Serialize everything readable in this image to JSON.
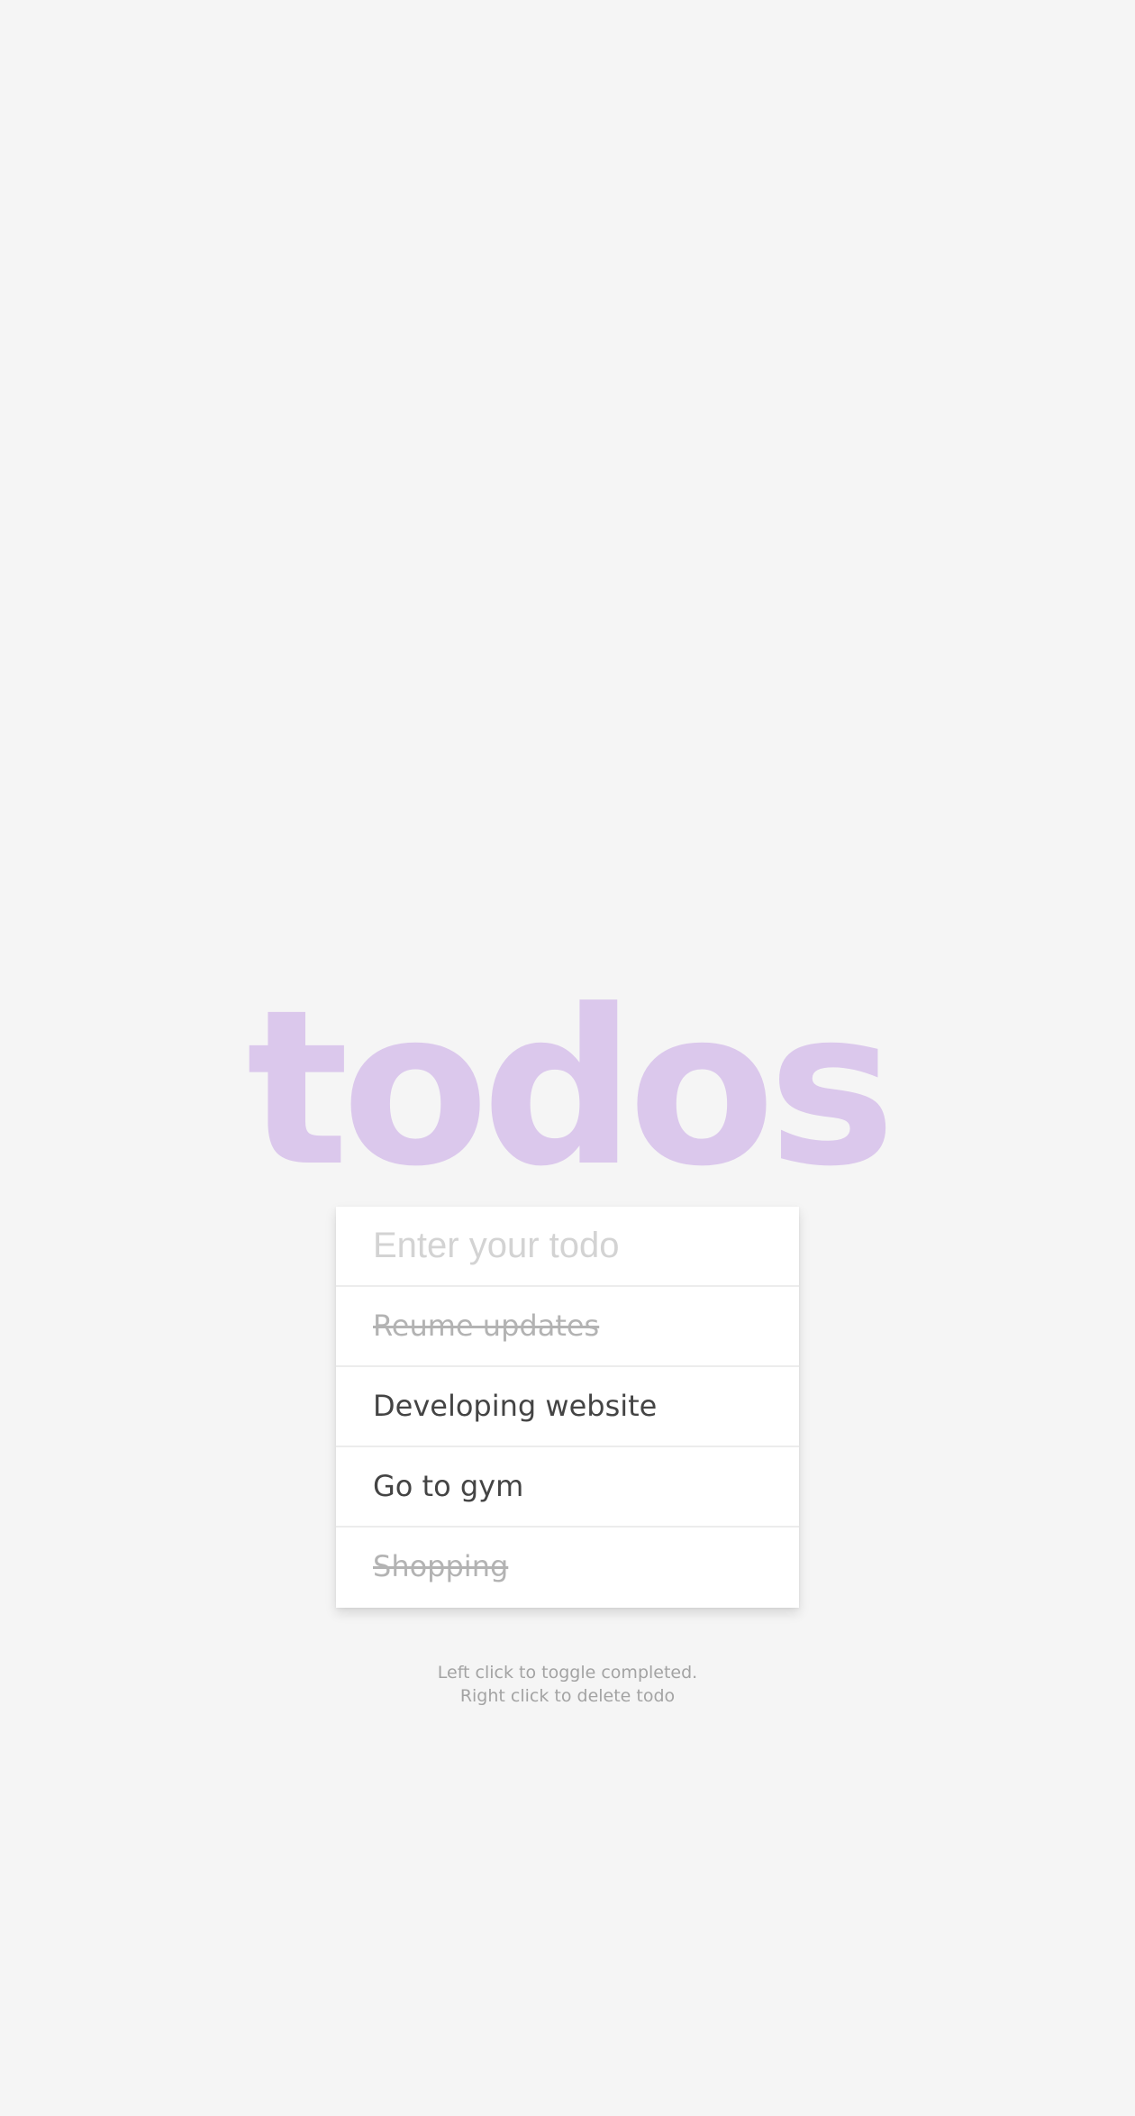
{
  "header": {
    "title": "todos"
  },
  "input": {
    "placeholder": "Enter your todo",
    "value": ""
  },
  "todos": [
    {
      "text": "Reume updates",
      "completed": true
    },
    {
      "text": "Developing website",
      "completed": false
    },
    {
      "text": "Go to gym",
      "completed": false
    },
    {
      "text": "Shopping",
      "completed": true
    }
  ],
  "instructions": {
    "line1": "Left click to toggle completed.",
    "line2": "Right click to delete todo"
  },
  "colors": {
    "background": "#f5f5f5",
    "title": "#dbc8ec",
    "card": "#ffffff",
    "text": "#444444",
    "completed_text": "#b3b3b3",
    "placeholder": "#d3d3d3",
    "instructions": "#a3a3a3"
  }
}
